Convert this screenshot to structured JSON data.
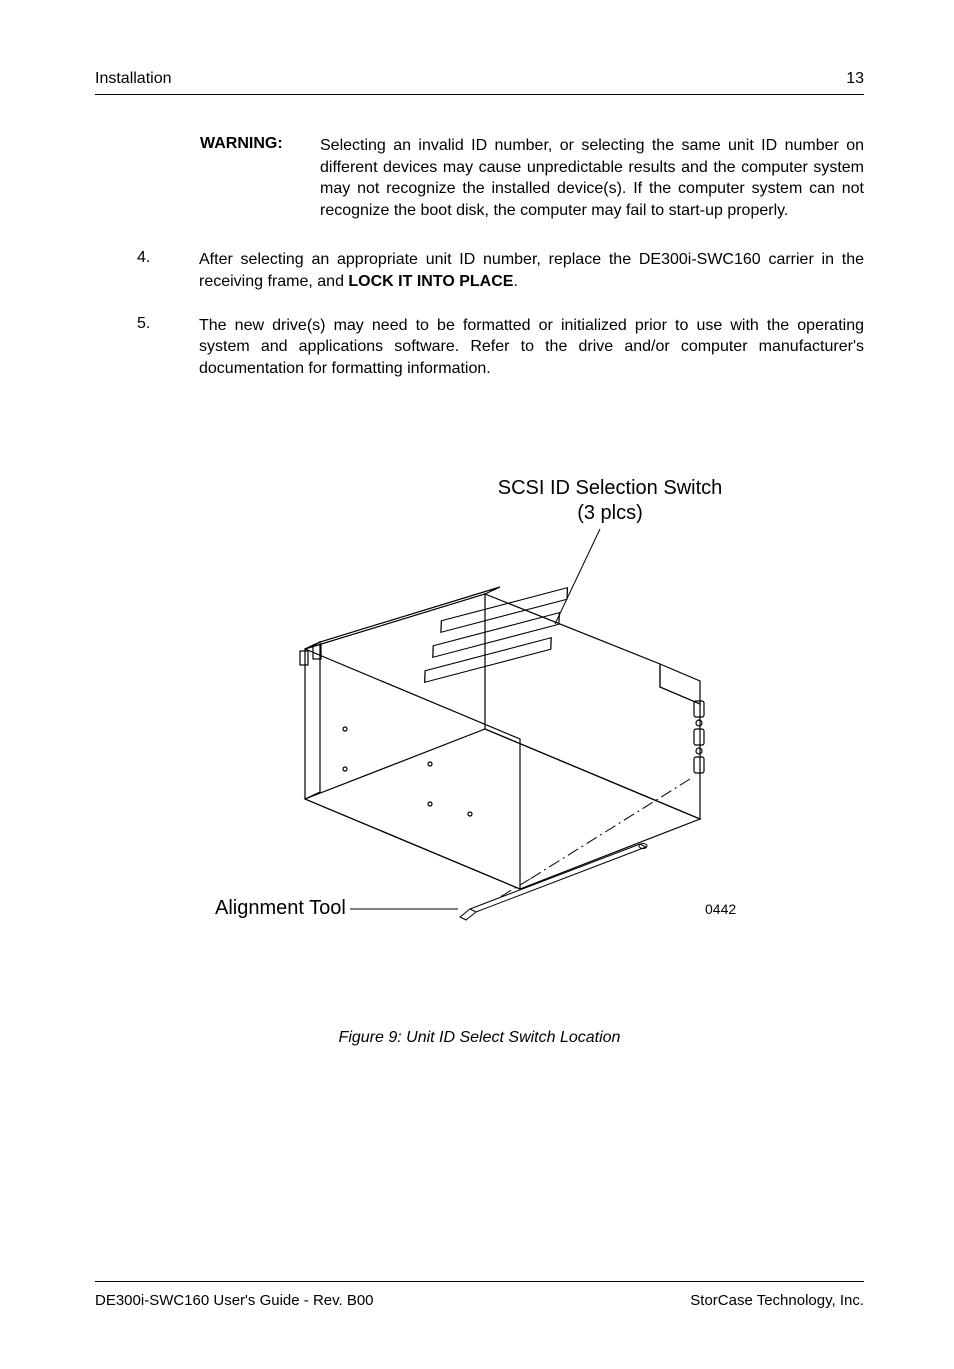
{
  "header": {
    "left": "Installation",
    "right": "13"
  },
  "warning": {
    "label": "WARNING:",
    "text": "Selecting an invalid ID number, or selecting the same unit ID number on different devices may cause unpredictable results and the computer system may not recognize the installed device(s).  If the computer system can not recognize the boot disk, the computer may fail to start-up properly."
  },
  "items": [
    {
      "number": "4.",
      "text_before": "After selecting an appropriate unit ID number, replace the DE300i-SWC160 carrier in the receiving frame, and ",
      "bold": "LOCK IT INTO PLACE",
      "text_after": "."
    },
    {
      "number": "5.",
      "text_before": "The new drive(s) may need to be formatted or initialized prior to use with the operating system and applications software.  Refer to the drive and/or computer manufacturer's documentation for formatting information.",
      "bold": "",
      "text_after": ""
    }
  ],
  "figure": {
    "label_top_1": "SCSI ID Selection Switch",
    "label_top_2": "(3 plcs)",
    "label_alignment": "Alignment Tool",
    "drawing_number": "0442",
    "caption": "Figure 9:  Unit ID Select Switch Location"
  },
  "footer": {
    "left": "DE300i-SWC160 User's Guide - Rev. B00",
    "right": "StorCase Technology, Inc."
  }
}
